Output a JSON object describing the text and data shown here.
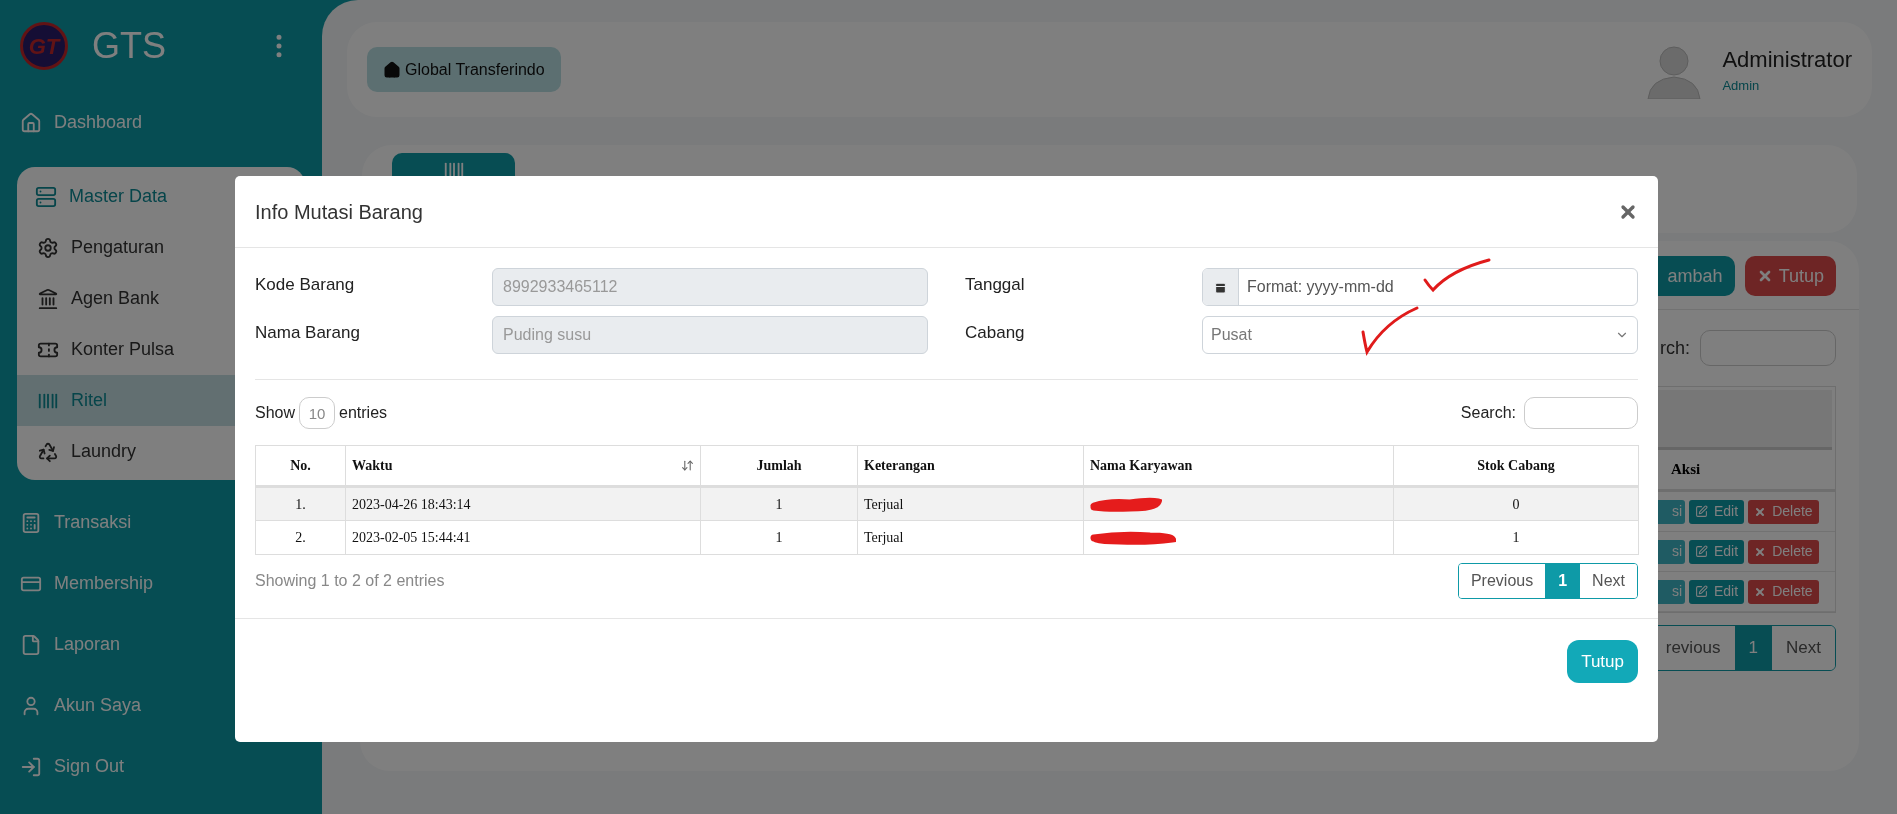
{
  "brand": {
    "logo_mark": "GT",
    "name": "GTS"
  },
  "sidebar": {
    "top_items": [
      {
        "label": "Dashboard",
        "selected": false
      }
    ],
    "group": {
      "label": "Master Data",
      "expanded": true,
      "items": [
        {
          "label": "Pengaturan",
          "selected": false
        },
        {
          "label": "Agen Bank",
          "selected": false
        },
        {
          "label": "Konter Pulsa",
          "selected": false
        },
        {
          "label": "Ritel",
          "selected": true
        },
        {
          "label": "Laundry",
          "selected": false
        }
      ]
    },
    "bottom_items": [
      {
        "label": "Transaksi",
        "selected": false
      },
      {
        "label": "Membership",
        "selected": false
      },
      {
        "label": "Laporan",
        "selected": false
      },
      {
        "label": "Akun Saya",
        "selected": false
      },
      {
        "label": "Sign Out",
        "selected": false
      }
    ]
  },
  "header": {
    "home_button": "Global Transferindo",
    "user": {
      "name": "Administrator",
      "role": "Admin"
    }
  },
  "background_panel": {
    "buttons": [
      {
        "label": "ambah",
        "kind": "primary"
      },
      {
        "label": "Tutup",
        "kind": "danger"
      }
    ],
    "search_label": "rch:",
    "table": {
      "column": "Aksi",
      "rows": [
        {
          "action": "si",
          "edit": "Edit",
          "delete": "Delete"
        },
        {
          "action": "si",
          "edit": "Edit",
          "delete": "Delete"
        },
        {
          "action": "si",
          "edit": "Edit",
          "delete": "Delete"
        }
      ]
    },
    "pagination": [
      {
        "label": "revious",
        "selected": false
      },
      {
        "label": "1",
        "selected": true
      },
      {
        "label": "Next",
        "selected": false
      }
    ]
  },
  "modal": {
    "title": "Info Mutasi Barang",
    "fields": [
      {
        "label": "Kode Barang",
        "kind": "text",
        "value": "8992933465112",
        "disabled": true
      },
      {
        "label": "Tanggal",
        "kind": "date",
        "placeholder": "Format: yyyy-mm-dd",
        "disabled": false
      },
      {
        "label": "Nama Barang",
        "kind": "text",
        "value": "Puding susu",
        "disabled": true
      },
      {
        "label": "Cabang",
        "kind": "select",
        "value": "Pusat",
        "disabled": false
      }
    ],
    "length": {
      "prefix": "Show",
      "value": "10",
      "suffix": "entries"
    },
    "search_label": "Search:",
    "table": {
      "columns": [
        {
          "label": "No.",
          "sortable": false
        },
        {
          "label": "Waktu",
          "sortable": true
        },
        {
          "label": "Jumlah",
          "sortable": false
        },
        {
          "label": "Keterangan",
          "sortable": false
        },
        {
          "label": "Nama Karyawan",
          "sortable": false
        },
        {
          "label": "Stok Cabang",
          "sortable": false
        }
      ],
      "rows": [
        {
          "no": "1.",
          "waktu": "2023-04-26 18:43:14",
          "jumlah": "1",
          "keterangan": "Terjual",
          "name_redacted": true,
          "stok": "0"
        },
        {
          "no": "2.",
          "waktu": "2023-02-05 15:44:41",
          "jumlah": "1",
          "keterangan": "Terjual",
          "name_redacted": true,
          "stok": "1"
        }
      ]
    },
    "info": "Showing 1 to 2 of 2 entries",
    "pagination": [
      {
        "label": "Previous",
        "selected": false
      },
      {
        "label": "1",
        "selected": true
      },
      {
        "label": "Next",
        "selected": false
      }
    ],
    "footer_button": "Tutup",
    "annotations": [
      {
        "kind": "checkmark"
      },
      {
        "kind": "checkmark"
      }
    ]
  }
}
